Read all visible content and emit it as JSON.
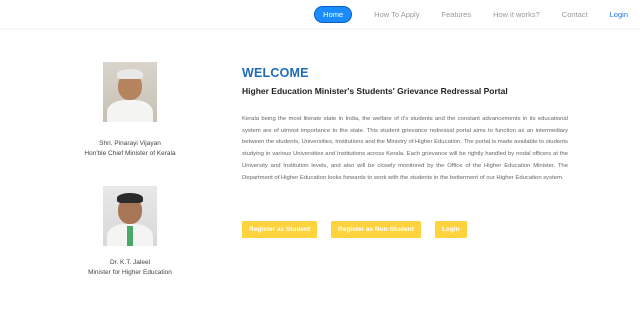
{
  "nav": {
    "items": [
      {
        "label": "Home"
      },
      {
        "label": "How To Apply"
      },
      {
        "label": "Features"
      },
      {
        "label": "How it works?"
      },
      {
        "label": "Contact"
      },
      {
        "label": "Login"
      }
    ],
    "active_color": "#1a8cff"
  },
  "profiles": [
    {
      "name": "Shri. Pinarayi Vijayan",
      "role": "Hon'ble Chief Minister of Kerala"
    },
    {
      "name": "Dr. K.T. Jaleel",
      "role": "Minister for Higher Education"
    }
  ],
  "main": {
    "welcome": "WELCOME",
    "subtitle": "Higher Education Minister's Students' Grievance Redressal Portal",
    "description": "Kerala being the most literate state in India, the welfare of it's students and the constant advancements in its educational system are of utmost importance to the state. This student grievance redressal portal aims to function as an intermediary between the students, Universities, Institutions and the Ministry of Higher Education. The portal is made available to students studying in various Universities and Institutions across Kerala. Each grievance will be rightly handled by nodal officers at the University and Institution levels, and also will be closely monitored by the Office of the Higher Education Minister. The Department of Higher Education looks forwards to work with the students in the betterment of our Higher Education system."
  },
  "buttons": {
    "register_student": "Register as Student",
    "register_non_student": "Register as Non-Student",
    "login": "Login",
    "color": "#ffd33d"
  }
}
